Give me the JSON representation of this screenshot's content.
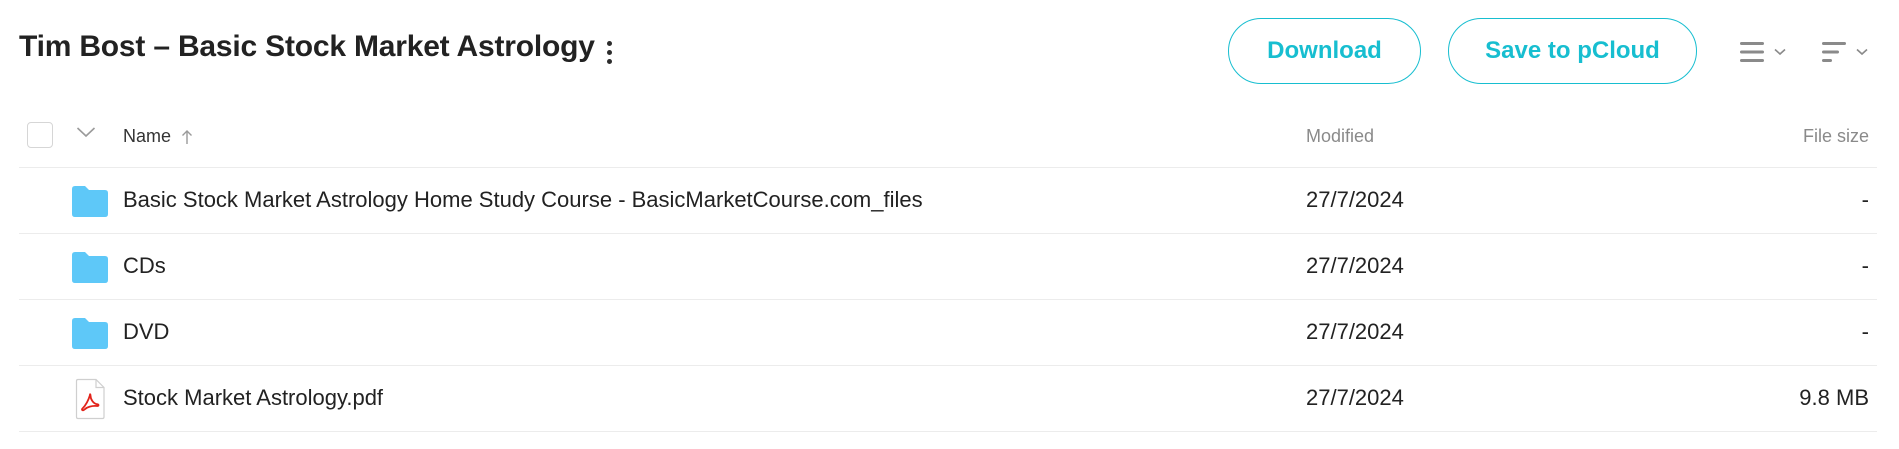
{
  "header": {
    "title": "Tim Bost – Basic Stock Market Astrology",
    "more_icon": "more-vertical-icon",
    "download_label": "Download",
    "save_label": "Save to pCloud",
    "view_icon": "list-view-icon",
    "sort_icon": "sort-icon",
    "accent_color": "#17bed0"
  },
  "columns": {
    "name": "Name",
    "modified": "Modified",
    "size": "File size",
    "sort_direction": "ascending"
  },
  "files": [
    {
      "type": "folder",
      "icon": "folder-icon",
      "name": "Basic Stock Market Astrology Home Study Course - BasicMarketCourse.com_files",
      "modified": "27/7/2024",
      "size": "-"
    },
    {
      "type": "folder",
      "icon": "folder-icon",
      "name": "CDs",
      "modified": "27/7/2024",
      "size": "-"
    },
    {
      "type": "folder",
      "icon": "folder-icon",
      "name": "DVD",
      "modified": "27/7/2024",
      "size": "-"
    },
    {
      "type": "pdf",
      "icon": "pdf-file-icon",
      "name": "Stock Market Astrology.pdf",
      "modified": "27/7/2024",
      "size": "9.8 MB"
    }
  ],
  "colors": {
    "folder": "#5ec8f8",
    "pdf_red": "#e2231a",
    "divider": "#ececec"
  }
}
